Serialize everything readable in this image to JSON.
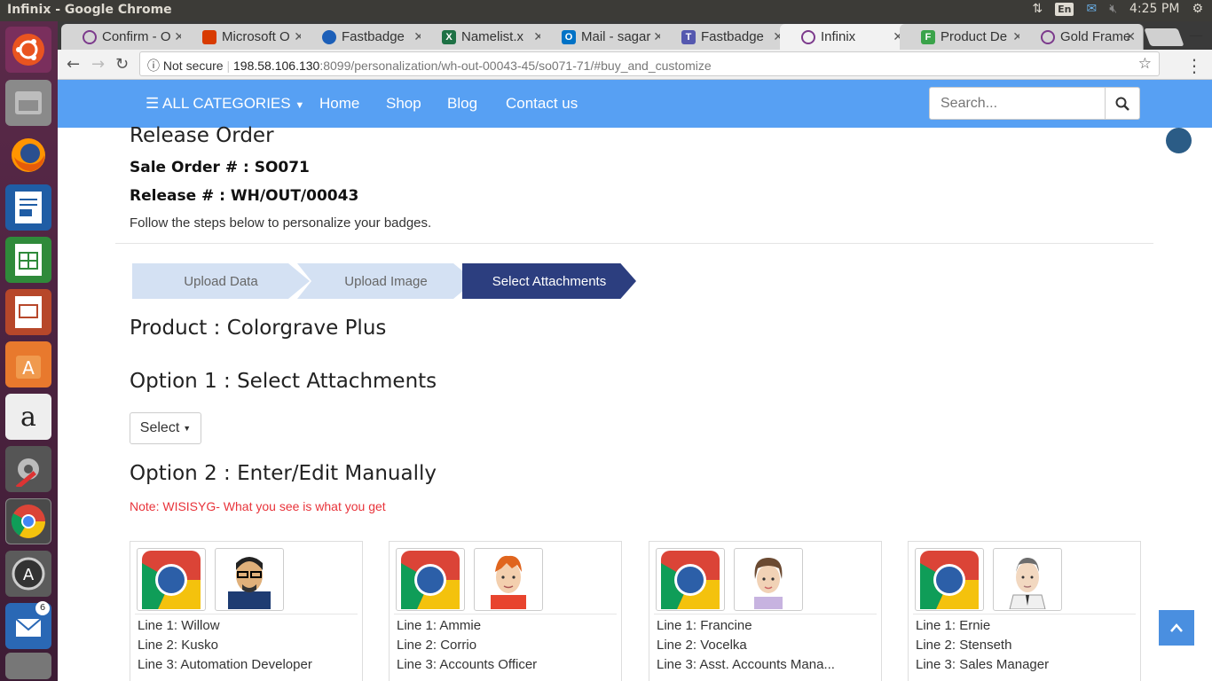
{
  "system": {
    "window_title": "Infinix - Google Chrome",
    "lang": "En",
    "time": "4:25 PM"
  },
  "tabs": [
    {
      "label": "Confirm - O",
      "icon": "circle-icon",
      "color": "#7c3a8c"
    },
    {
      "label": "Microsoft O",
      "icon": "office-icon",
      "color": "#d83b01"
    },
    {
      "label": "Fastbadge",
      "icon": "cloud-icon",
      "color": "#1c5fb8"
    },
    {
      "label": "Namelist.x",
      "icon": "excel-icon",
      "color": "#1e7145"
    },
    {
      "label": "Mail - sagar",
      "icon": "outlook-icon",
      "color": "#0072c6"
    },
    {
      "label": "Fastbadge",
      "icon": "teams-icon",
      "color": "#5558af"
    },
    {
      "label": "Infinix",
      "icon": "circle-icon",
      "color": "#7c3a8c",
      "active": true
    },
    {
      "label": "Product De",
      "icon": "f-icon",
      "color": "#3aa34a"
    },
    {
      "label": "Gold Frame",
      "icon": "circle-icon",
      "color": "#7c3a8c"
    }
  ],
  "omnibox": {
    "security": "Not secure",
    "host": "198.58.106.130",
    "path": ":8099/personalization/wh-out-00043-45/so071-71/#buy_and_customize"
  },
  "nav": {
    "categories": "ALL CATEGORIES",
    "home": "Home",
    "shop": "Shop",
    "blog": "Blog",
    "contact": "Contact us",
    "search_placeholder": "Search..."
  },
  "order": {
    "title": "Release Order",
    "sale_order": "Sale Order # : SO071",
    "release": "Release # : WH/OUT/00043",
    "instructions": "Follow the steps below to personalize your badges."
  },
  "steps": [
    "Upload Data",
    "Upload Image",
    "Select Attachments"
  ],
  "product": "Product : Colorgrave Plus",
  "option1": {
    "title": "Option 1 : Select Attachments",
    "select_label": "Select"
  },
  "option2": {
    "title": "Option 2 : Enter/Edit Manually",
    "note": "Note: WISISYG- What you see is what you get"
  },
  "cards": [
    {
      "line1": "Willow",
      "line2": "Kusko",
      "line3": "Automation Developer",
      "avatar": "man-glasses-avatar"
    },
    {
      "line1": "Ammie",
      "line2": "Corrio",
      "line3": "Accounts Officer",
      "avatar": "redhead-avatar"
    },
    {
      "line1": "Francine",
      "line2": "Vocelka",
      "line3": "Asst. Accounts Mana...",
      "avatar": "woman-avatar"
    },
    {
      "line1": "Ernie",
      "line2": "Stenseth",
      "line3": "Sales Manager",
      "avatar": "businessman-avatar"
    }
  ],
  "card_labels": {
    "l1": "Line 1:",
    "l2": "Line 2:",
    "l3": "Line 3:"
  },
  "colors": {
    "nav_bg": "#57a0f3",
    "step_active": "#2c3e7f",
    "step_inactive": "#d4e1f3",
    "note": "#e8333a"
  }
}
